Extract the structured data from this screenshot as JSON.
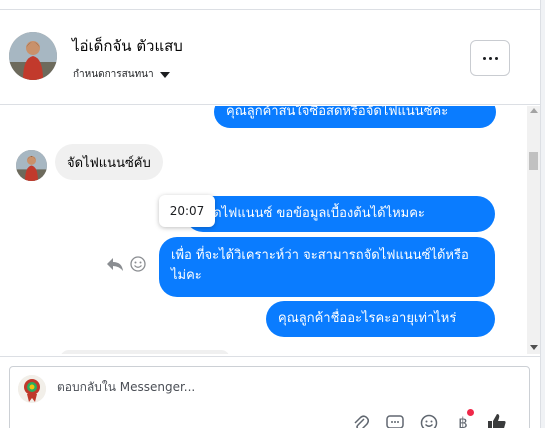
{
  "header": {
    "name": "ไอ่เด็กจัน ตัวแสบ",
    "sub_label": "กำหนดการสนทนา"
  },
  "messages": {
    "partial_top": "คุณลูกค้าสนใจซื้อสดหรือจัดไฟแนนซ์คะ",
    "incoming": "จัดไฟแนนซ์คับ",
    "out_1": "มีจัดไฟแนนซ์ ขอข้อมูลเบื้องต้นได้ไหมคะ",
    "out_2": "เพื่อ ที่จะได้วิเคราะห์ว่า จะสามารถจัดไฟแนนซ์ได้หรือไม่คะ",
    "out_3": "คุณลูกค้าชื่ออะไรคะอายุเท่าไหร่",
    "timestamp": "20:07"
  },
  "composer": {
    "placeholder": "ตอบกลับใน Messenger..."
  },
  "colors": {
    "outgoing_bubble": "#0a7cff",
    "incoming_bubble": "#f0f0f0",
    "notification": "#f02849"
  },
  "icons": {
    "more": "more-horizontal-icon",
    "reply": "reply-icon",
    "react": "smiley-icon",
    "attach": "paperclip-icon",
    "sticker": "chat-sticker-icon",
    "emoji": "emoji-icon",
    "payment": "baht-icon",
    "like": "thumbs-up-icon"
  }
}
